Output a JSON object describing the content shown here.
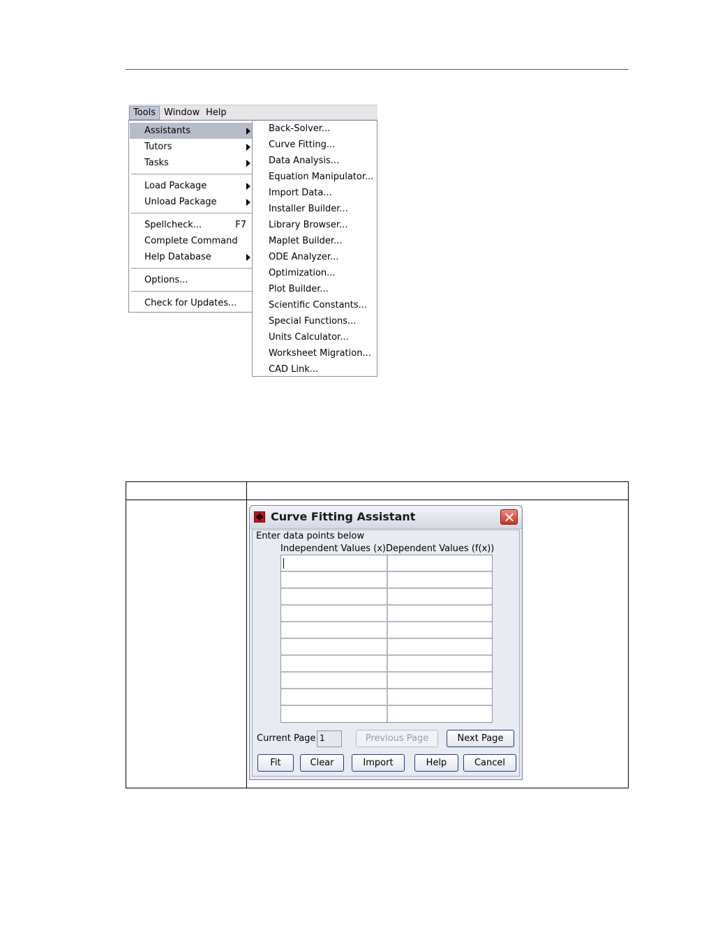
{
  "menubar": {
    "items": [
      {
        "label": "Tools",
        "active": true
      },
      {
        "label": "Window"
      },
      {
        "label": "Help"
      }
    ]
  },
  "tools_menu": {
    "items": [
      {
        "label": "Assistants"
      },
      {
        "label": "Tutors"
      },
      {
        "label": "Tasks"
      },
      {
        "label": "Load Package"
      },
      {
        "label": "Unload Package"
      },
      {
        "label": "Spellcheck...",
        "accelerator": "F7"
      },
      {
        "label": "Complete Command"
      },
      {
        "label": "Help Database"
      },
      {
        "label": "Options..."
      },
      {
        "label": "Check for Updates..."
      }
    ]
  },
  "assistants_menu": {
    "items": [
      "Back-Solver...",
      "Curve Fitting...",
      "Data Analysis...",
      "Equation Manipulator...",
      "Import Data...",
      "Installer Builder...",
      "Library Browser...",
      "Maplet Builder...",
      "ODE Analyzer...",
      "Optimization...",
      "Plot Builder...",
      "Scientific Constants...",
      "Special Functions...",
      "Units Calculator...",
      "Worksheet Migration...",
      "CAD Link..."
    ]
  },
  "dialog": {
    "title": "Curve Fitting Assistant",
    "instructions": "Enter data points below",
    "col_x": "Independent Values (x)",
    "col_y": "Dependent Values (f(x))",
    "current_page_label": "Current Page",
    "current_page_value": "1",
    "buttons": {
      "previous": "Previous Page",
      "next": "Next Page",
      "fit": "Fit",
      "clear": "Clear",
      "import": "Import",
      "help": "Help",
      "cancel": "Cancel"
    },
    "colors": {
      "border": "#1f3c82",
      "close": "#c8331f"
    }
  }
}
